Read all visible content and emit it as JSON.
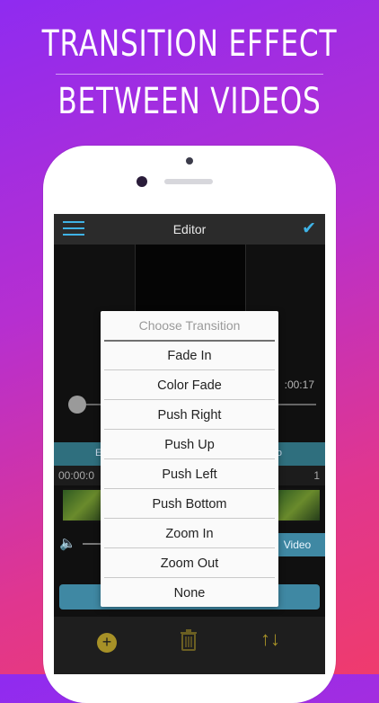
{
  "headline": {
    "line1": "TRANSITION EFFECT",
    "line2": "BETWEEN VIDEOS"
  },
  "editor": {
    "title": "Editor",
    "menu_icon": "hamburger-menu-icon",
    "confirm_icon": "checkmark-icon",
    "right_time": ":00:17",
    "segment_left_fragment": "E",
    "segment_right_fragment": "o",
    "timeline_start": "00:00:0",
    "timeline_end": "1",
    "video_button": "Video",
    "accent_color": "#3fb3e6"
  },
  "toolbar": {
    "add_icon": "plus-circle-icon",
    "trash_icon": "trash-icon",
    "sort_icon": "sort-arrows-icon"
  },
  "transition_dialog": {
    "title": "Choose Transition",
    "options": [
      "Fade In",
      "Color Fade",
      "Push Right",
      "Push Up",
      "Push Left",
      "Push Bottom",
      "Zoom In",
      "Zoom Out",
      "None"
    ]
  }
}
